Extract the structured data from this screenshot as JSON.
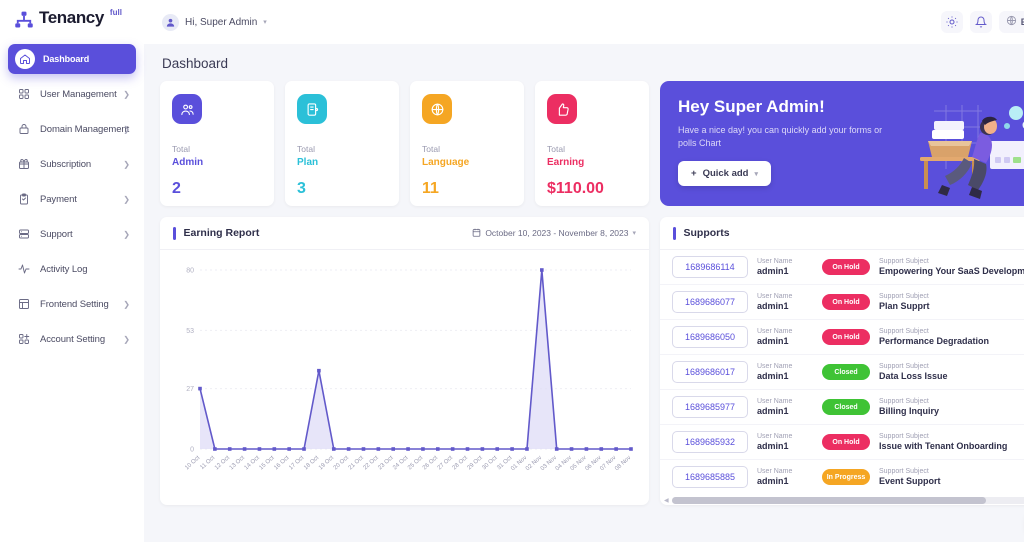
{
  "brand": {
    "name": "Tenancy",
    "sup": "full",
    "logo_icon": "sitemap-icon"
  },
  "topbar": {
    "user_greeting": "Hi, Super Admin",
    "avatar_icon": "user-avatar-icon",
    "caret_icon": "chevron-down-icon",
    "theme_icon": "sun-icon",
    "notification_icon": "bell-icon",
    "globe_icon": "globe-icon",
    "language": "EN",
    "language_caret_icon": "chevron-down-icon"
  },
  "sidebar": {
    "items": [
      {
        "label": "Dashboard",
        "icon": "home-icon",
        "active": true,
        "chevron": false
      },
      {
        "label": "User Management",
        "icon": "users-grid-icon",
        "active": false,
        "chevron": true
      },
      {
        "label": "Domain Management",
        "icon": "lock-icon",
        "active": false,
        "chevron": true
      },
      {
        "label": "Subscription",
        "icon": "gift-icon",
        "active": false,
        "chevron": true
      },
      {
        "label": "Payment",
        "icon": "clipboard-icon",
        "active": false,
        "chevron": true
      },
      {
        "label": "Support",
        "icon": "server-icon",
        "active": false,
        "chevron": true
      },
      {
        "label": "Activity Log",
        "icon": "activity-pulse-icon",
        "active": false,
        "chevron": false
      },
      {
        "label": "Frontend Setting",
        "icon": "layout-grid-icon",
        "active": false,
        "chevron": true
      },
      {
        "label": "Account Setting",
        "icon": "user-settings-icon",
        "active": false,
        "chevron": true
      }
    ]
  },
  "page": {
    "title": "Dashboard"
  },
  "stats": [
    {
      "total_label": "Total",
      "label": "Admin",
      "value": "2",
      "icon": "users-icon",
      "color": "#5a4fdb",
      "bg": "#5a4fdb"
    },
    {
      "total_label": "Total",
      "label": "Plan",
      "value": "3",
      "icon": "plan-box-icon",
      "color": "#2bc0d8",
      "bg": "#2bc0d8"
    },
    {
      "total_label": "Total",
      "label": "Language",
      "value": "11",
      "icon": "globe-icon",
      "color": "#f5a623",
      "bg": "#f5a623"
    },
    {
      "total_label": "Total",
      "label": "Earning",
      "value": "$110.00",
      "icon": "thumbs-up-icon",
      "color": "#ec2e62",
      "bg": "#ec2e62"
    }
  ],
  "banner": {
    "title": "Hey Super Admin!",
    "subtitle": "Have a nice day! you can quickly add your forms or polls Chart",
    "button_label": "Quick add",
    "plus_icon": "plus-icon",
    "caret_icon": "chevron-down-icon",
    "illustration": "person-at-desk-illustration",
    "bg_color": "#5a4fdb"
  },
  "earning_report": {
    "title": "Earning Report",
    "date_range": "October 10, 2023 - November 8, 2023",
    "calendar_icon": "calendar-icon",
    "caret_icon": "chevron-down-icon"
  },
  "chart_data": {
    "type": "area",
    "title": "Earning Report",
    "xlabel": "",
    "ylabel": "",
    "ylim": [
      0,
      80
    ],
    "yticks": [
      0,
      27,
      53,
      80
    ],
    "grid": true,
    "legend": false,
    "line_color": "#6259ca",
    "fill_color": "#dfdcf7",
    "categories": [
      "10 Oct",
      "11 Oct",
      "12 Oct",
      "13 Oct",
      "14 Oct",
      "15 Oct",
      "16 Oct",
      "17 Oct",
      "18 Oct",
      "19 Oct",
      "20 Oct",
      "21 Oct",
      "22 Oct",
      "23 Oct",
      "24 Oct",
      "25 Oct",
      "26 Oct",
      "27 Oct",
      "28 Oct",
      "29 Oct",
      "30 Oct",
      "31 Oct",
      "01 Nov",
      "02 Nov",
      "03 Nov",
      "04 Nov",
      "05 Nov",
      "06 Nov",
      "07 Nov",
      "08 Nov"
    ],
    "values": [
      27,
      0,
      0,
      0,
      0,
      0,
      0,
      0,
      35,
      0,
      0,
      0,
      0,
      0,
      0,
      0,
      0,
      0,
      0,
      0,
      0,
      0,
      0,
      80,
      0,
      0,
      0,
      0,
      0,
      0
    ]
  },
  "supports": {
    "title": "Supports",
    "labels": {
      "user_name": "User Name",
      "support_subject": "Support Subject"
    },
    "rows": [
      {
        "id": "1689686114",
        "user": "admin1",
        "status": "On Hold",
        "status_color": "#ec2e62",
        "subject": "Empowering Your SaaS Developmer"
      },
      {
        "id": "1689686077",
        "user": "admin1",
        "status": "On Hold",
        "status_color": "#ec2e62",
        "subject": "Plan Supprt"
      },
      {
        "id": "1689686050",
        "user": "admin1",
        "status": "On Hold",
        "status_color": "#ec2e62",
        "subject": "Performance Degradation"
      },
      {
        "id": "1689686017",
        "user": "admin1",
        "status": "Closed",
        "status_color": "#3fc335",
        "subject": "Data Loss Issue"
      },
      {
        "id": "1689685977",
        "user": "admin1",
        "status": "Closed",
        "status_color": "#3fc335",
        "subject": "Billing Inquiry"
      },
      {
        "id": "1689685932",
        "user": "admin1",
        "status": "On Hold",
        "status_color": "#ec2e62",
        "subject": "Issue with Tenant Onboarding"
      },
      {
        "id": "1689685885",
        "user": "admin1",
        "status": "In Progress",
        "status_color": "#f5a623",
        "subject": "Event Support"
      }
    ]
  },
  "floating_widget": {
    "icon": "assistant-orb-icon"
  }
}
